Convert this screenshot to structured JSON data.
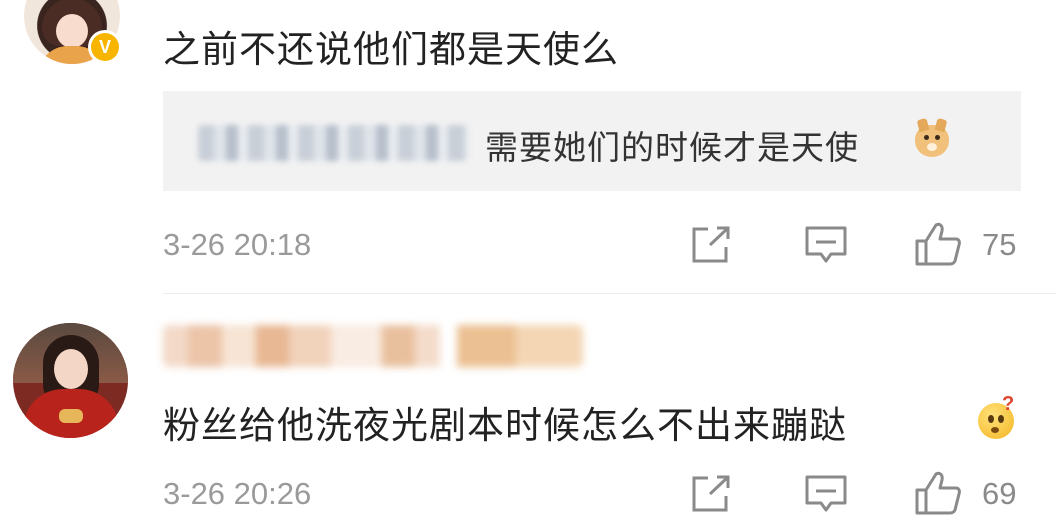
{
  "comments": [
    {
      "text": "之前不还说他们都是天使么",
      "badge": "V",
      "reply": {
        "text": "需要她们的时候才是天使",
        "emoji": "doge-emoji"
      },
      "time": "3-26 20:18",
      "likes": "75"
    },
    {
      "text": "粉丝给他洗夜光剧本时候怎么不出来蹦跶",
      "emoji": "thinking-emoji",
      "time": "3-26 20:26",
      "likes": "69"
    }
  ],
  "icons": {
    "share": "share-icon",
    "comment": "comment-icon",
    "like": "thumbs-up-icon"
  },
  "colors": {
    "background": "#ffffff",
    "text": "#222222",
    "meta": "#9a9a9a",
    "reply_bg": "#f2f2f2",
    "badge": "#f7b500"
  }
}
